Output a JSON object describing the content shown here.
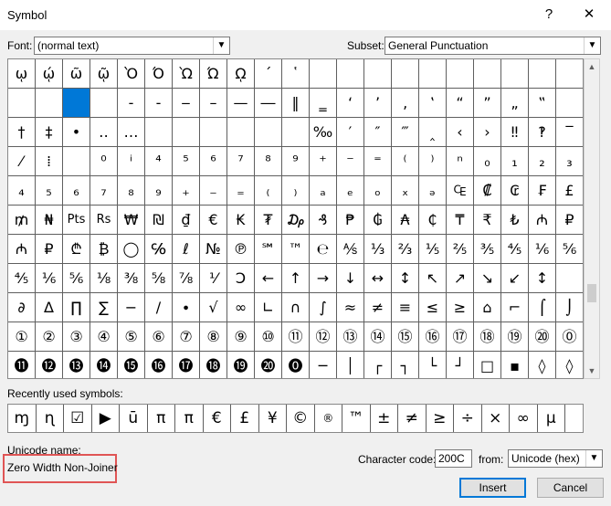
{
  "window": {
    "title": "Symbol",
    "help_btn": "?",
    "close_btn": "✕"
  },
  "font": {
    "label": "Font:",
    "value": "(normal text)"
  },
  "subset": {
    "label": "Subset:",
    "value": "General Punctuation"
  },
  "symbols": [
    "ῳ",
    "ῴ",
    "ῶ",
    "ῷ",
    "Ὸ",
    "Ό",
    "Ὼ",
    "Ώ",
    "ῼ",
    "´",
    "῾",
    "",
    "",
    "",
    "",
    "",
    "",
    "",
    "",
    "",
    "",
    "",
    "",
    "",
    "",
    "‐",
    "‑",
    "‒",
    "–",
    "—",
    "―",
    "‖",
    "‗",
    "‘",
    "’",
    "‚",
    "‛",
    "“",
    "”",
    "„",
    "‟",
    "",
    "†",
    "‡",
    "•",
    "‥",
    "…",
    "",
    "",
    "",
    "",
    "",
    "",
    "‰",
    "′",
    "″",
    "‴",
    "‸",
    "‹",
    "›",
    "‼",
    "‽",
    "‾",
    "⁄",
    "⁞",
    "",
    "⁰",
    "ⁱ",
    "⁴",
    "⁵",
    "⁶",
    "⁷",
    "⁸",
    "⁹",
    "⁺",
    "⁻",
    "⁼",
    "⁽",
    "⁾",
    "ⁿ",
    "₀",
    "₁",
    "₂",
    "₃",
    "₄",
    "₅",
    "₆",
    "₇",
    "₈",
    "₉",
    "₊",
    "₋",
    "₌",
    "₍",
    "₎",
    "ₐ",
    "ₑ",
    "ₒ",
    "ₓ",
    "ₔ",
    "₠",
    "₡",
    "₢",
    "₣",
    "£",
    "₥",
    "₦",
    "Pts",
    "Rs",
    "₩",
    "₪",
    "₫",
    "€",
    "₭",
    "₮",
    "₯",
    "₰",
    "₱",
    "₲",
    "₳",
    "₵",
    "₸",
    "₹",
    "₺",
    "₼",
    "₽",
    "₼",
    "₽",
    "₾",
    "₿",
    "◯",
    "℅",
    "ℓ",
    "№",
    "℗",
    "℠",
    "™",
    "℮",
    "⅍",
    "⅓",
    "⅔",
    "⅕",
    "⅖",
    "⅗",
    "⅘",
    "⅙",
    "⅚",
    "⅘",
    "⅙",
    "⅚",
    "⅛",
    "⅜",
    "⅝",
    "⅞",
    "⅟",
    "Ↄ",
    "←",
    "↑",
    "→",
    "↓",
    "↔",
    "↕",
    "↖",
    "↗",
    "↘",
    "↙",
    "↕",
    "",
    "∂",
    "∆",
    "∏",
    "∑",
    "−",
    "∕",
    "∙",
    "√",
    "∞",
    "∟",
    "∩",
    "∫",
    "≈",
    "≠",
    "≡",
    "≤",
    "≥",
    "⌂",
    "⌐",
    "⌠",
    "⌡",
    "①",
    "②",
    "③",
    "④",
    "⑤",
    "⑥",
    "⑦",
    "⑧",
    "⑨",
    "⑩",
    "⑪",
    "⑫",
    "⑬",
    "⑭",
    "⑮",
    "⑯",
    "⑰",
    "⑱",
    "⑲",
    "⑳",
    "⓪",
    "⓫",
    "⓬",
    "⓭",
    "⓮",
    "⓯",
    "⓰",
    "⓱",
    "⓲",
    "⓳",
    "⓴",
    "⓿",
    "─",
    "│",
    "┌",
    "┐",
    "└",
    "┘",
    "□",
    "▪",
    "◊",
    "◊"
  ],
  "selected_index": 23,
  "recent": {
    "label": "Recently used symbols:",
    "items": [
      "ɱ",
      "ɳ",
      "☑",
      "▶",
      "ū",
      "π",
      "π",
      "€",
      "£",
      "¥",
      "©",
      "®",
      "™",
      "±",
      "≠",
      "≥",
      "÷",
      "×",
      "∞",
      "µ"
    ]
  },
  "unicode": {
    "label": "Unicode name:",
    "value": "Zero Width Non-Joiner"
  },
  "charcode": {
    "label": "Character code:",
    "value": "200C"
  },
  "from": {
    "label": "from:",
    "value": "Unicode (hex)"
  },
  "buttons": {
    "insert": "Insert",
    "cancel": "Cancel"
  }
}
